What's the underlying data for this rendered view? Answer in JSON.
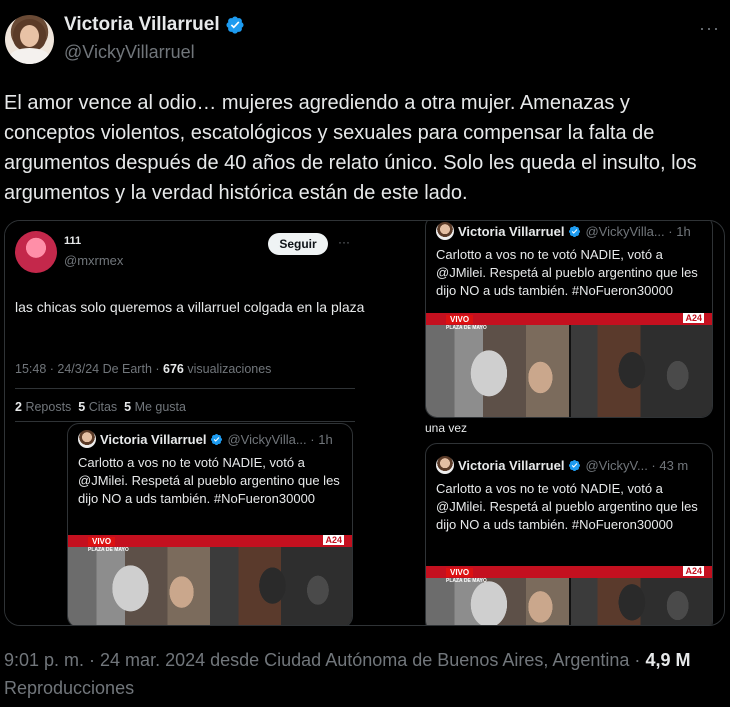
{
  "header": {
    "name": "Victoria Villarruel",
    "handle": "@VickyVillarruel",
    "more_label": "···"
  },
  "tweet": {
    "text": "El amor vence al odio… mujeres agrediendo a otra mujer. Amenazas y conceptos violentos, escatológicos y sexuales para compensar la falta de argumentos después de 40 años de relato único. Solo les queda el insulto, los argumentos y la verdad histórica están de este lado."
  },
  "embedded": {
    "user_name": "111",
    "user_handle": "@mxrmex",
    "follow_label": "Seguir",
    "more_label": "···",
    "text": "las chicas solo queremos a villarruel colgada en la plaza",
    "meta_time": "15:48 · 24/3/24 De Earth ·",
    "meta_views": "676",
    "meta_views_label": "visualizaciones",
    "reposts": "2",
    "reposts_label": "Reposts",
    "quotes": "5",
    "quotes_label": "Citas",
    "likes": "5",
    "likes_label": "Me gusta",
    "quoted": {
      "name": "Victoria Villarruel",
      "handle": "@VickyVilla... · 1h",
      "text": "Carlotto a vos no te votó NADIE, votó a @JMilei. Respetá al pueblo argentino que les dijo NO a uds también. #NoFueron30000"
    }
  },
  "right_top": {
    "name": "Victoria Villarruel",
    "handle": "@VickyVilla... · 1h",
    "text": "Carlotto a vos no te votó NADIE, votó a @JMilei. Respetá al pueblo argentino que les dijo NO a uds también. #NoFueron30000",
    "caption": "una vez"
  },
  "right_bottom": {
    "name": "Victoria Villarruel",
    "handle": "@VickyV... · 43 m",
    "text": "Carlotto a vos no te votó NADIE, votó a @JMilei. Respetá al pueblo argentino que les dijo NO a uds también. #NoFueron30000"
  },
  "video_overlay": {
    "live": "VIVO",
    "place": "PLAZA DE MAYO",
    "channel": "A24"
  },
  "footer": {
    "timestamp": "9:01 p. m. · 24 mar. 2024 desde Ciudad Autónoma de Buenos Aires, Argentina ·",
    "views": "4,9 M",
    "views_label": "Reproducciones"
  },
  "colors": {
    "background": "#000000",
    "text": "#e7e9ea",
    "secondary": "#71767b",
    "verified": "#1d9bf0",
    "border": "#2f3336"
  }
}
